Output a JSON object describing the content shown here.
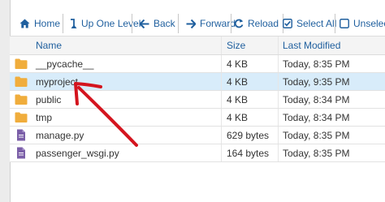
{
  "toolbar": {
    "home": "Home",
    "up": "Up One Level",
    "back": "Back",
    "forward": "Forward",
    "reload": "Reload",
    "select_all": "Select All",
    "unselect_all": "Unselect A"
  },
  "table": {
    "headers": {
      "name": "Name",
      "size": "Size",
      "modified": "Last Modified"
    },
    "rows": [
      {
        "icon": "folder-icon",
        "name": "__pycache__",
        "size": "4 KB",
        "modified": "Today, 8:35 PM"
      },
      {
        "icon": "folder-icon",
        "name": "myproject",
        "size": "4 KB",
        "modified": "Today, 9:35 PM"
      },
      {
        "icon": "folder-icon",
        "name": "public",
        "size": "4 KB",
        "modified": "Today, 8:34 PM"
      },
      {
        "icon": "folder-icon",
        "name": "tmp",
        "size": "4 KB",
        "modified": "Today, 8:34 PM"
      },
      {
        "icon": "file-icon",
        "name": "manage.py",
        "size": "629 bytes",
        "modified": "Today, 8:35 PM"
      },
      {
        "icon": "file-icon",
        "name": "passenger_wsgi.py",
        "size": "164 bytes",
        "modified": "Today, 8:35 PM"
      }
    ]
  },
  "colors": {
    "link": "#1f5f9e",
    "folder": "#f0ad3c",
    "file": "#7b5fa8",
    "selected_row": "#d8ecfa",
    "annotation_arrow": "#d4141e"
  },
  "annotation": {
    "icon": "red-arrow-icon"
  }
}
